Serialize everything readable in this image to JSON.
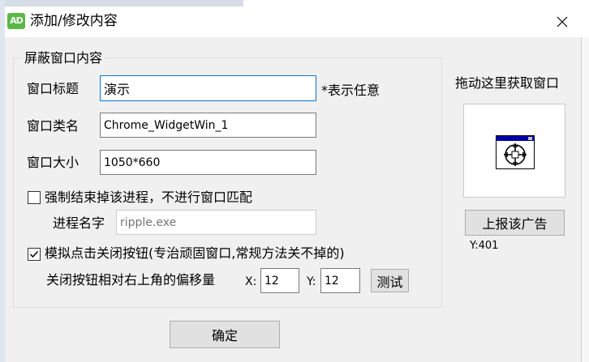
{
  "window": {
    "title": "添加/修改内容",
    "app_icon_text": "AD"
  },
  "group": {
    "title": "屏蔽窗口内容",
    "window_title_label": "窗口标题",
    "window_title_value": "演示",
    "wildcard_note": "*表示任意",
    "class_name_label": "窗口类名",
    "class_name_value": "Chrome_WidgetWin_1",
    "size_label": "窗口大小",
    "size_value": "1050*660",
    "kill_process_label": "强制结束掉该进程，不进行窗口匹配",
    "kill_process_checked": false,
    "process_name_label": "进程名字",
    "process_name_placeholder": "ripple.exe",
    "simulate_close_label": "模拟点击关闭按钮(专治顽固窗口,常规方法关不掉的)",
    "simulate_close_checked": true,
    "offset_label": "关闭按钮相对右上角的偏移量",
    "x_label": "X:",
    "x_value": "12",
    "y_label": "Y:",
    "y_value": "12",
    "test_button": "测试"
  },
  "picker": {
    "label": "拖动这里获取窗口",
    "icon": "window-crosshair-icon",
    "report_button": "上报该广告",
    "coord_text": "Y:401"
  },
  "footer": {
    "ok_button": "确定"
  },
  "colors": {
    "window_bg": "#f0f0f0",
    "focus_border": "#0078d7",
    "button_bg": "#e1e1e1",
    "app_icon": "#58b947"
  }
}
